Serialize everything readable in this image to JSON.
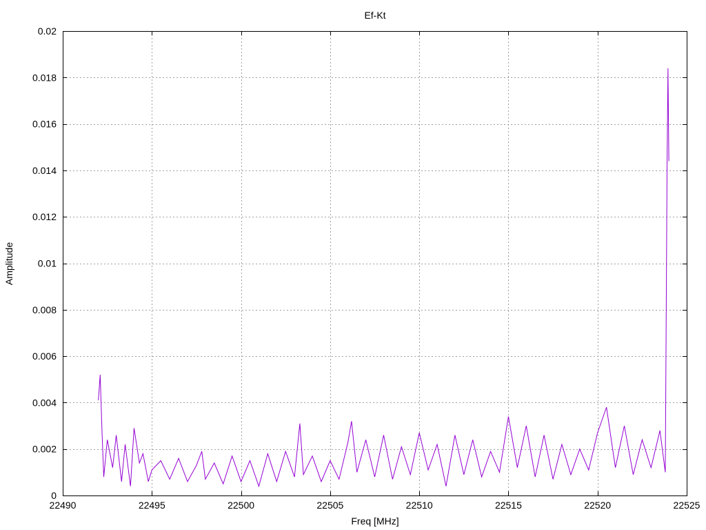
{
  "chart_data": {
    "type": "line",
    "title": "Ef-Kt",
    "xlabel": "Freq [MHz]",
    "ylabel": "Amplitude",
    "xlim": [
      22490,
      22525
    ],
    "ylim": [
      0,
      0.02
    ],
    "x_ticks": [
      "22490",
      "22495",
      "22500",
      "22505",
      "22510",
      "22515",
      "22520",
      "22525"
    ],
    "y_ticks": [
      "0",
      "0.002",
      "0.004",
      "0.006",
      "0.008",
      "0.01",
      "0.012",
      "0.014",
      "0.016",
      "0.018",
      "0.02"
    ],
    "grid": true,
    "legend": "none",
    "series": [
      {
        "color": "#9400d3",
        "x": [
          22492.0,
          22492.1,
          22492.2,
          22492.3,
          22492.5,
          22492.8,
          22493.0,
          22493.3,
          22493.5,
          22493.8,
          22494.0,
          22494.3,
          22494.5,
          22494.8,
          22495.0,
          22495.5,
          22496.0,
          22496.5,
          22497.0,
          22497.5,
          22497.8,
          22498.0,
          22498.5,
          22499.0,
          22499.5,
          22500.0,
          22500.5,
          22501.0,
          22501.5,
          22502.0,
          22502.5,
          22503.0,
          22503.3,
          22503.5,
          22504.0,
          22504.5,
          22505.0,
          22505.5,
          22506.0,
          22506.2,
          22506.5,
          22507.0,
          22507.5,
          22508.0,
          22508.5,
          22509.0,
          22509.5,
          22510.0,
          22510.5,
          22511.0,
          22511.5,
          22512.0,
          22512.5,
          22513.0,
          22513.5,
          22514.0,
          22514.5,
          22515.0,
          22515.5,
          22516.0,
          22516.5,
          22517.0,
          22517.5,
          22518.0,
          22518.5,
          22519.0,
          22519.5,
          22520.0,
          22520.5,
          22521.0,
          22521.5,
          22522.0,
          22522.5,
          22523.0,
          22523.5,
          22523.8,
          22523.9,
          22523.95,
          22524.0
        ],
        "y": [
          0.0041,
          0.0052,
          0.0028,
          0.0008,
          0.0024,
          0.0012,
          0.0026,
          0.0006,
          0.0022,
          0.0004,
          0.0029,
          0.0014,
          0.0018,
          0.0006,
          0.0011,
          0.0015,
          0.0007,
          0.0016,
          0.0006,
          0.0013,
          0.0019,
          0.0007,
          0.0014,
          0.0005,
          0.0017,
          0.0006,
          0.0015,
          0.0004,
          0.0018,
          0.0006,
          0.0019,
          0.0008,
          0.0031,
          0.0009,
          0.0017,
          0.0006,
          0.0015,
          0.0007,
          0.0023,
          0.0032,
          0.001,
          0.0024,
          0.0008,
          0.0026,
          0.0007,
          0.0021,
          0.0009,
          0.0027,
          0.0011,
          0.0022,
          0.0004,
          0.0026,
          0.0009,
          0.0024,
          0.0008,
          0.0019,
          0.001,
          0.0034,
          0.0012,
          0.003,
          0.0008,
          0.0026,
          0.0007,
          0.0022,
          0.0009,
          0.002,
          0.0011,
          0.0027,
          0.0038,
          0.0012,
          0.003,
          0.0009,
          0.0024,
          0.0012,
          0.0028,
          0.001,
          0.0143,
          0.0184,
          0.0144
        ]
      }
    ]
  }
}
